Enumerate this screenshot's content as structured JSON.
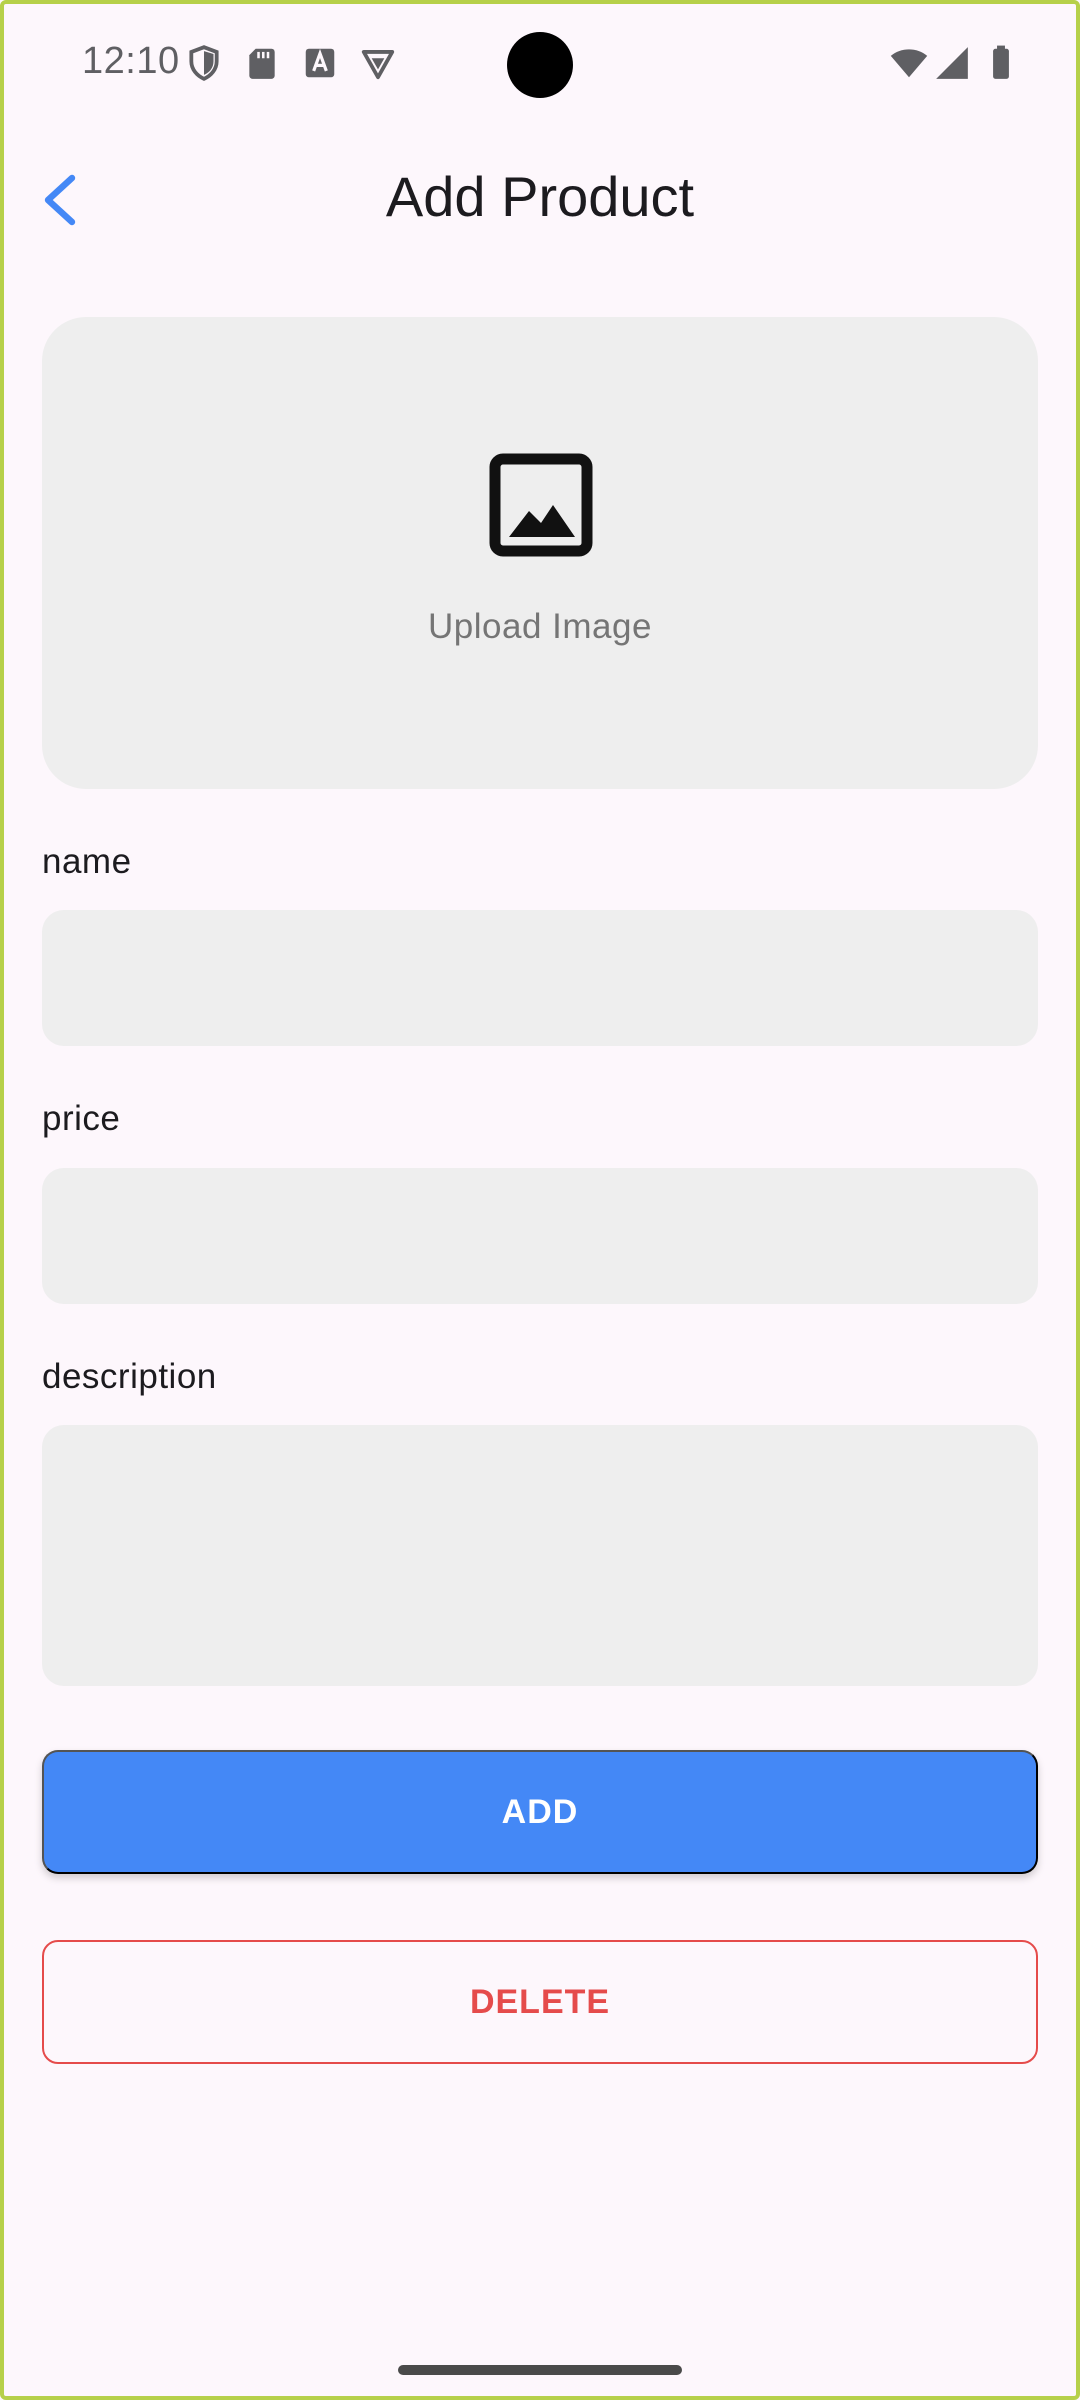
{
  "status_bar": {
    "time": "12:10",
    "left_icons": [
      "shield-icon",
      "sd-card-icon",
      "font-download-icon",
      "vpn-icon"
    ],
    "right_icons": [
      "wifi-icon",
      "cellular-signal-icon",
      "battery-icon"
    ]
  },
  "app_bar": {
    "back_icon": "chevron-left-icon",
    "title": "Add Product"
  },
  "upload": {
    "icon": "image-icon",
    "label": "Upload Image"
  },
  "form": {
    "name": {
      "label": "name",
      "value": "",
      "placeholder": ""
    },
    "price": {
      "label": "price",
      "value": "",
      "placeholder": ""
    },
    "description": {
      "label": "description",
      "value": "",
      "placeholder": ""
    }
  },
  "actions": {
    "add_label": "ADD",
    "delete_label": "DELETE"
  },
  "colors": {
    "background": "#FDF7FC",
    "accent": "#4488F6",
    "danger": "#E54B4B",
    "field_fill": "#EEEEEE",
    "muted_text": "#757575"
  }
}
